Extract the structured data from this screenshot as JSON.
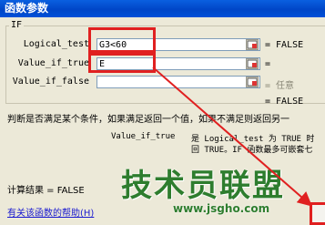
{
  "window": {
    "title": "函数参数"
  },
  "function_group": {
    "name": "IF"
  },
  "args": [
    {
      "label": "Logical_test",
      "value": "G3<60",
      "result": "= FALSE"
    },
    {
      "label": "Value_if_true",
      "value": "E",
      "result": "="
    },
    {
      "label": "Value_if_false",
      "value": "",
      "result": "= 任意"
    }
  ],
  "overall_result": "= FALSE",
  "description": {
    "main": "判断是否满足某个条件，如果满足返回一个值，如果不满足则返回另一",
    "arg_name": "Value_if_true",
    "arg_line1": "是 Logical_test 为 TRUE 时",
    "arg_line2": "回 TRUE。IF 函数最多可嵌套七"
  },
  "footer": {
    "calc_result": "计算结果 = FALSE",
    "help_link": "有关该函数的帮助(H)"
  },
  "watermark": {
    "text": "技术员联盟",
    "url": "www.jsgho.com"
  },
  "colors": {
    "highlight": "#e02020",
    "titlebar": "#0046c7",
    "dialog_bg": "#ece9d8"
  }
}
